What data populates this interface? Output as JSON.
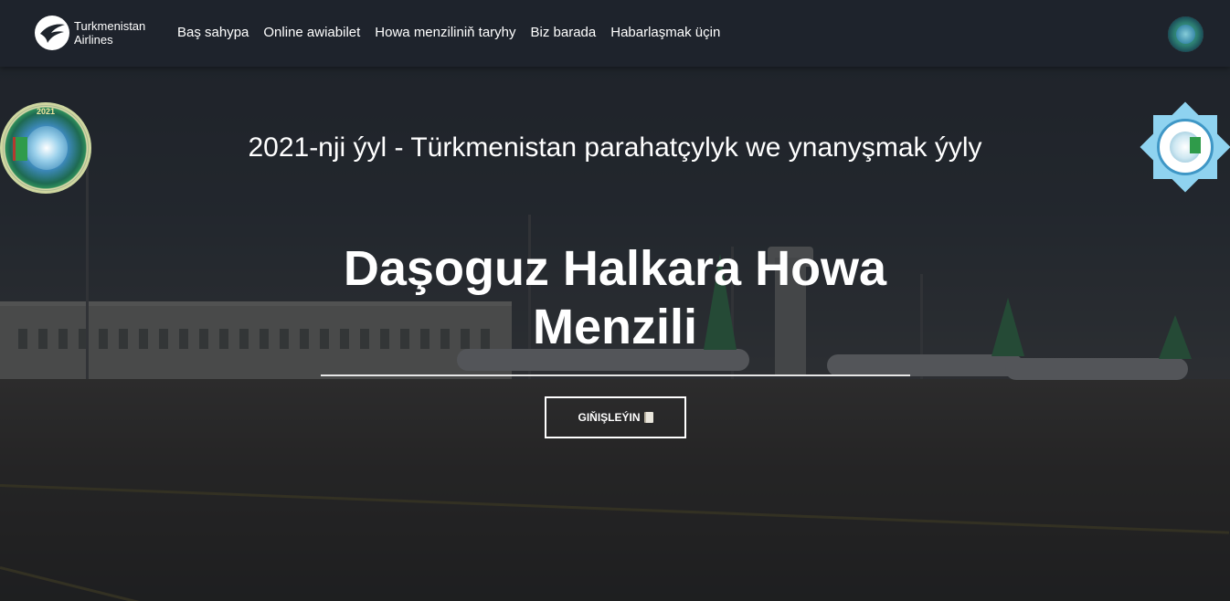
{
  "brand": {
    "name_line1": "Turkmenistan",
    "name_line2": "Airlines"
  },
  "nav": {
    "items": [
      {
        "label": "Baş sahypa"
      },
      {
        "label": "Online awiabilet"
      },
      {
        "label": "Howa menziliniň taryhy"
      },
      {
        "label": "Biz barada"
      },
      {
        "label": "Habarlaşmak üçin"
      }
    ]
  },
  "emblems": {
    "left_year": "2021"
  },
  "hero": {
    "slogan": "2021-nji ýyl - Türkmenistan parahatçylyk we ynanyşmak ýyly",
    "title": "Daşoguz Halkara Howa Menzili",
    "cta_label": "GIŇIŞLEÝIN"
  },
  "colors": {
    "header_bg": "#1e242c",
    "text": "#ffffff",
    "emblem_blue": "#8fd3f0",
    "emblem_green": "#2e8c5a"
  },
  "icons": {
    "logo": "bird-logo-icon",
    "cta": "book-icon",
    "emblem_small": "round-emblem-icon"
  }
}
